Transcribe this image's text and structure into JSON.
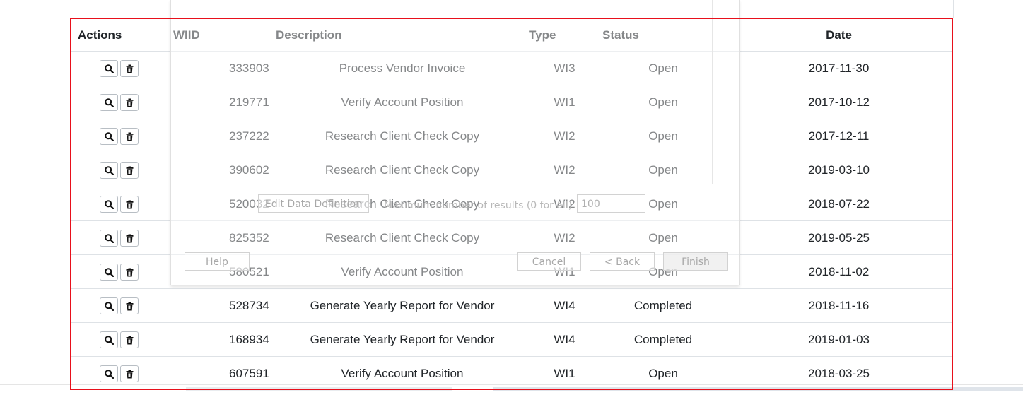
{
  "table": {
    "headers": {
      "actions": "Actions",
      "wiid": "WIID",
      "description": "Description",
      "type": "Type",
      "status": "Status",
      "date": "Date"
    },
    "rows": [
      {
        "wiid": "333903",
        "description": "Process Vendor Invoice",
        "type": "WI3",
        "status": "Open",
        "date": "2017-11-30"
      },
      {
        "wiid": "219771",
        "description": "Verify Account Position",
        "type": "WI1",
        "status": "Open",
        "date": "2017-10-12"
      },
      {
        "wiid": "237222",
        "description": "Research Client Check Copy",
        "type": "WI2",
        "status": "Open",
        "date": "2017-12-11"
      },
      {
        "wiid": "390602",
        "description": "Research Client Check Copy",
        "type": "WI2",
        "status": "Open",
        "date": "2019-03-10"
      },
      {
        "wiid": "520032",
        "description": "Research Client Check Copy",
        "type": "WI2",
        "status": "Open",
        "date": "2018-07-22"
      },
      {
        "wiid": "825352",
        "description": "Research Client Check Copy",
        "type": "WI2",
        "status": "Open",
        "date": "2019-05-25"
      },
      {
        "wiid": "580521",
        "description": "Verify Account Position",
        "type": "WI1",
        "status": "Open",
        "date": "2018-11-02"
      },
      {
        "wiid": "528734",
        "description": "Generate Yearly Report for Vendor",
        "type": "WI4",
        "status": "Completed",
        "date": "2018-11-16"
      },
      {
        "wiid": "168934",
        "description": "Generate Yearly Report for Vendor",
        "type": "WI4",
        "status": "Completed",
        "date": "2019-01-03"
      },
      {
        "wiid": "607591",
        "description": "Verify Account Position",
        "type": "WI1",
        "status": "Open",
        "date": "2018-03-25"
      }
    ],
    "row_actions": {
      "view_icon": "search-icon",
      "delete_icon": "trash-icon"
    }
  },
  "dialog": {
    "edit_data_definition_label": "Edit Data Definition",
    "max_results_label": "Maximum number of results (0 for all)",
    "max_results_value": "100",
    "help_label": "Help",
    "cancel_label": "Cancel",
    "back_label": "< Back",
    "finish_label": "Finish"
  },
  "colors": {
    "highlight_frame": "#e8101b",
    "grid_line": "#dee2e6"
  }
}
